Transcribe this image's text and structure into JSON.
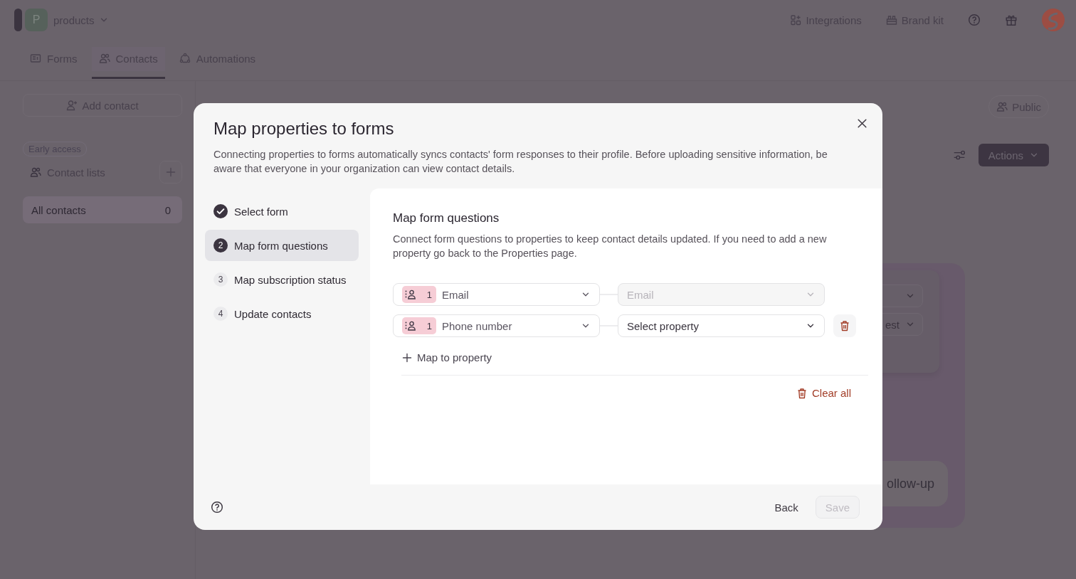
{
  "topbar": {
    "workspace_initial": "P",
    "workspace": "products",
    "links": [
      {
        "label": "Integrations",
        "kind": "grid"
      },
      {
        "label": "Brand kit",
        "kind": "kit"
      }
    ]
  },
  "tabs": [
    {
      "label": "Forms",
      "kind": "form",
      "selected": false
    },
    {
      "label": "Contacts",
      "kind": "people",
      "selected": true
    },
    {
      "label": "Automations",
      "kind": "flow",
      "selected": false
    }
  ],
  "sidebar": {
    "add_button": "Add contact",
    "badge": "Early access",
    "section": "Contact lists",
    "lists": [
      {
        "label": "All contacts",
        "count": "0",
        "selected": true
      }
    ]
  },
  "main": {
    "visibility_button": "Public",
    "actions_button": "Actions",
    "background_fragments": [
      "est",
      "ollow-up"
    ]
  },
  "modal": {
    "title": "Map properties to forms",
    "description": "Connecting properties to forms automatically syncs contacts' form responses to their profile. Before uploading sensitive information, be aware that everyone in your organization can view contact details.",
    "steps": [
      {
        "label": "Select form",
        "completed": true,
        "selected": false
      },
      {
        "number": "2",
        "label": "Map form questions",
        "completed": false,
        "selected": true
      },
      {
        "number": "3",
        "label": "Map subscription status",
        "completed": false,
        "selected": false
      },
      {
        "number": "4",
        "label": "Update contacts",
        "completed": false,
        "selected": false
      }
    ],
    "panel": {
      "heading": "Map form questions",
      "description": "Connect form questions to properties to keep contact details updated. If you need to add a new property go back to the Properties page.",
      "mappings": [
        {
          "badge_count": "1",
          "question": "Email",
          "property": "Email",
          "property_disabled": true,
          "deletable": false
        },
        {
          "badge_count": "1",
          "question": "Phone number",
          "property": "Select property",
          "property_disabled": false,
          "deletable": true
        }
      ],
      "add_button": "Map to property",
      "clear_button": "Clear all"
    },
    "footer": {
      "back_button": "Back",
      "save_button": "Save",
      "save_disabled": true
    }
  }
}
